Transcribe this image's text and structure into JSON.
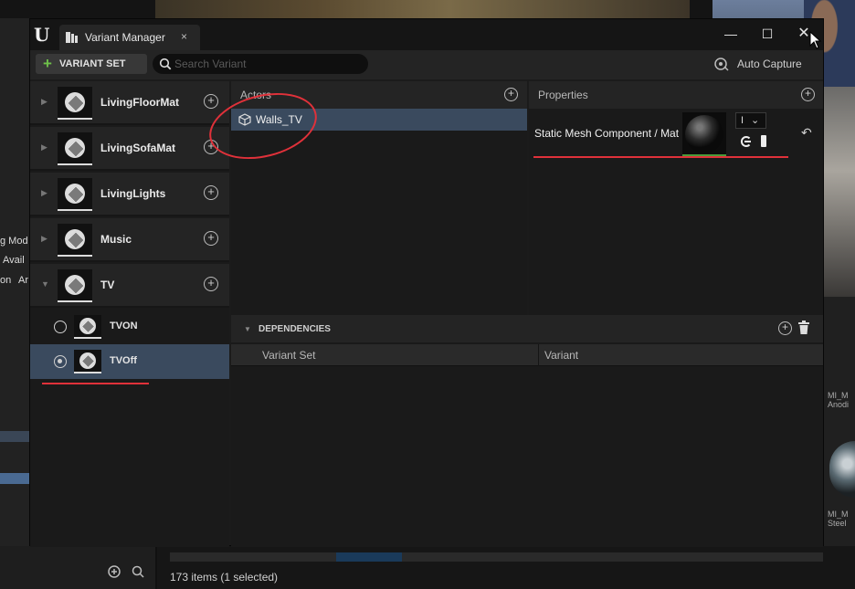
{
  "background": {
    "left_panel_lines": [
      "g Mod",
      "Avail",
      "on",
      "Ar"
    ],
    "right_thumb_labels": [
      "MI_M\nAnodi",
      "MI_M\nSteel"
    ],
    "status_text": "173 items (1 selected)"
  },
  "window": {
    "tab_title": "Variant Manager",
    "tab_close": "×",
    "minimize": "—",
    "maximize": "☐",
    "close": "✕"
  },
  "toolbar": {
    "variant_set_plus": "+",
    "variant_set_label": "VARIANT SET",
    "search_placeholder": "Search Variant",
    "auto_capture_label": "Auto Capture"
  },
  "variant_sets": [
    {
      "name": "LivingFloorMat",
      "expanded": false
    },
    {
      "name": "LivingSofaMat",
      "expanded": false
    },
    {
      "name": "LivingLights",
      "expanded": false
    },
    {
      "name": "Music",
      "expanded": false
    },
    {
      "name": "TV",
      "expanded": true
    }
  ],
  "variants": [
    {
      "name": "TVON",
      "selected": false
    },
    {
      "name": "TVOff",
      "selected": true
    }
  ],
  "actors": {
    "title": "Actors",
    "items": [
      "Walls_TV"
    ]
  },
  "properties": {
    "title": "Properties",
    "rows": [
      {
        "label": "Static Mesh Component / Mat",
        "combo_value": "I"
      }
    ]
  },
  "dependencies": {
    "title": "DEPENDENCIES",
    "columns": [
      "Variant Set",
      "Variant"
    ]
  },
  "colors": {
    "accent_selection": "#3a4a5e",
    "add_green": "#6ec04a",
    "annotation_red": "#e0313a"
  }
}
